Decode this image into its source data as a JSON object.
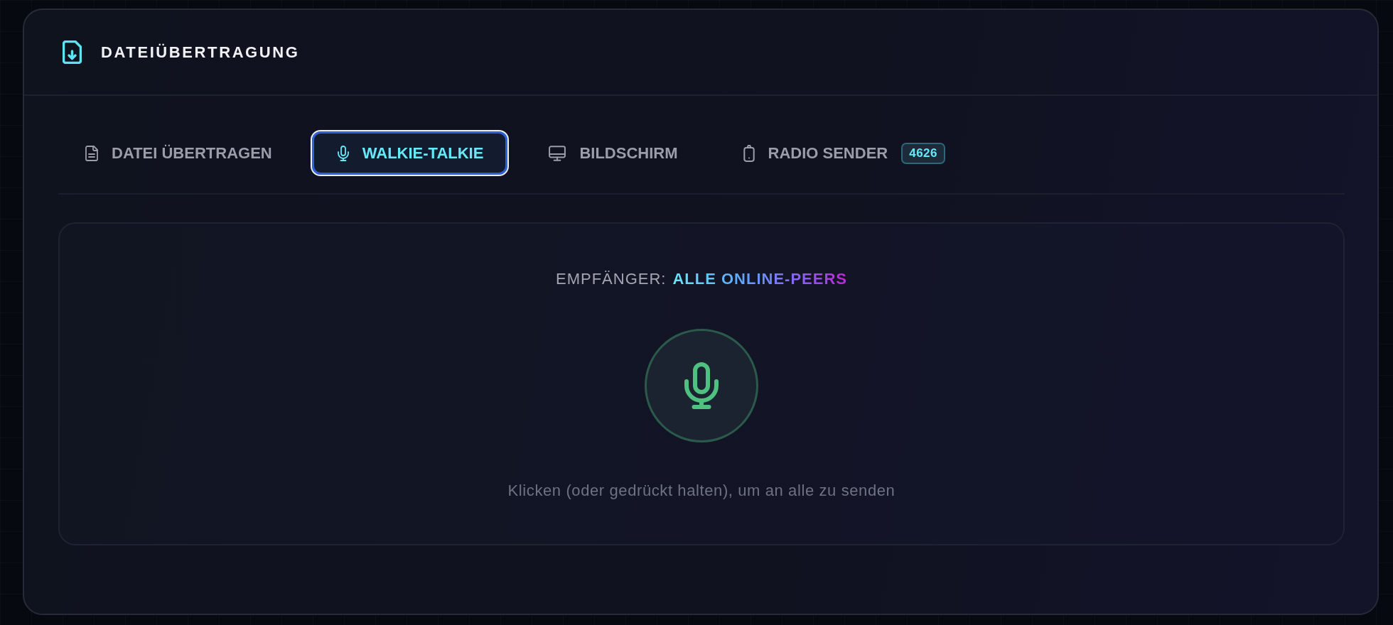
{
  "panel": {
    "title": "DATEIÜBERTRAGUNG"
  },
  "tabs": [
    {
      "label": "DATEI ÜBERTRAGEN",
      "selected": false
    },
    {
      "label": "WALKIE-TALKIE",
      "selected": true
    },
    {
      "label": "BILDSCHIRM",
      "selected": false
    },
    {
      "label": "RADIO SENDER",
      "selected": false,
      "badge": "4626"
    }
  ],
  "walkie_talkie": {
    "recipient_label": "EMPFÄNGER:",
    "recipient_value": "ALLE ONLINE-PEERS",
    "hint": "Klicken (oder gedrückt halten), um an alle zu senden"
  }
}
